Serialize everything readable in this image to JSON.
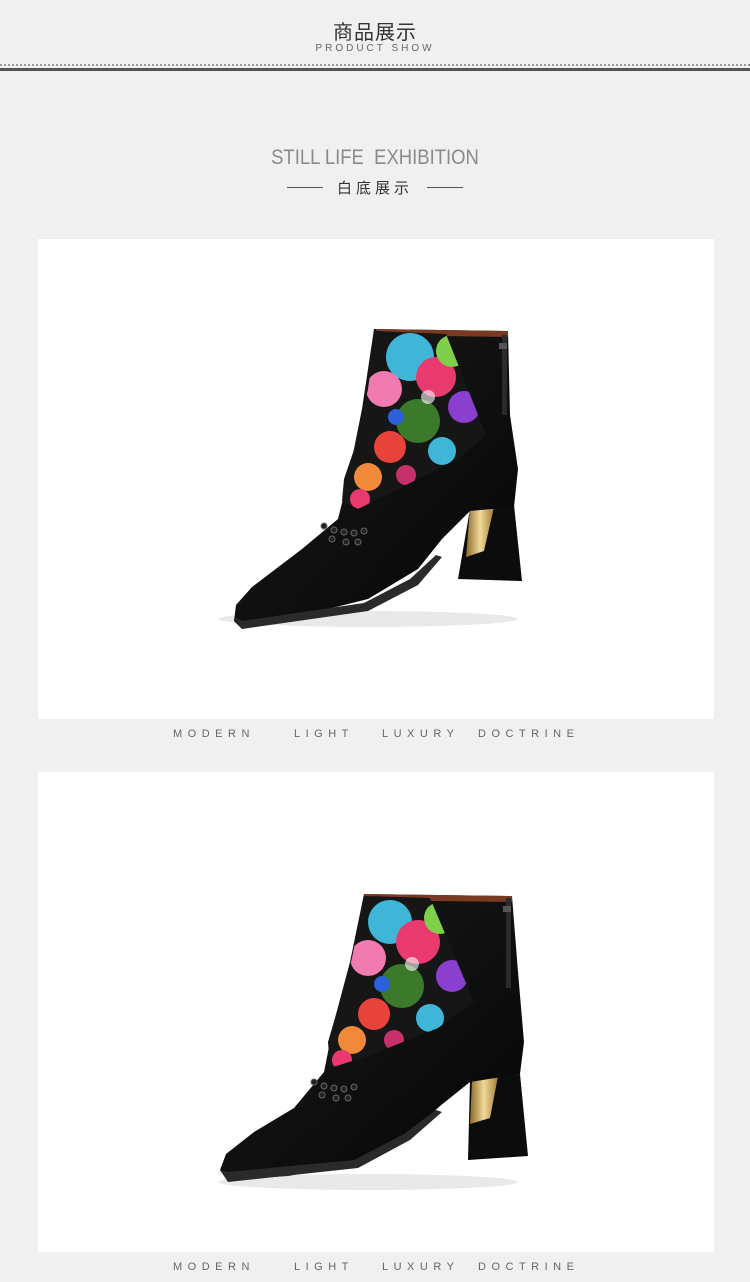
{
  "header": {
    "title": "商品展示",
    "subtitle": "PRODUCT SHOW"
  },
  "section": {
    "title": "STILL LIFE  EXHIBITION",
    "subtitle": "白底展示"
  },
  "products": [
    {
      "image": "embroidered-black-suede-ankle-boot-side-view",
      "caption": [
        "MODERN",
        "LIGHT",
        "LUXURY",
        "DOCTRINE"
      ]
    },
    {
      "image": "embroidered-black-suede-ankle-boot-front-angle-view",
      "caption": [
        "MODERN",
        "LIGHT",
        "LUXURY",
        "DOCTRINE"
      ]
    }
  ],
  "colors": {
    "background": "#f0f0f0",
    "card": "#ffffff",
    "boot": "#111111",
    "heel_accent": "#c9a24a"
  }
}
